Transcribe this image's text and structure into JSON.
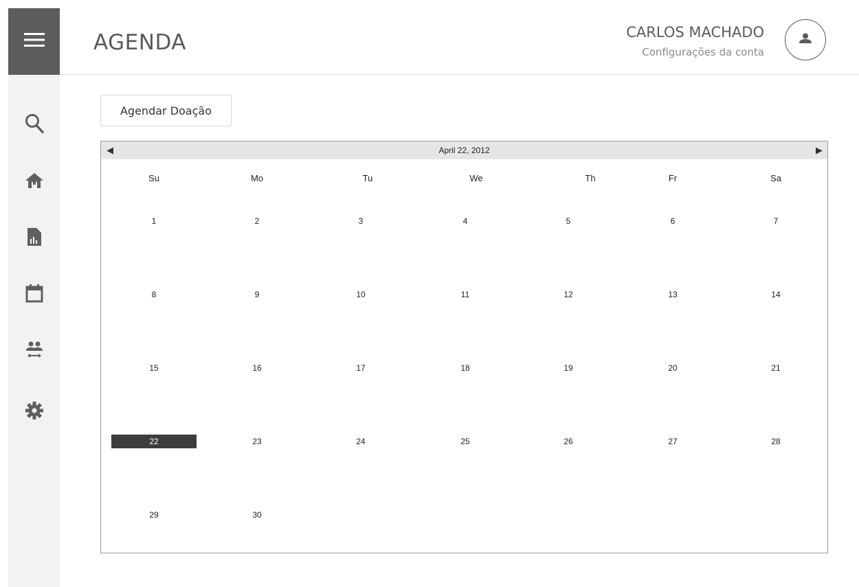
{
  "header": {
    "title": "AGENDA",
    "user_name": "CARLOS MACHADO",
    "account_settings": "Configurações da conta"
  },
  "sidebar": {
    "icons": [
      "menu-icon",
      "search-icon",
      "home-icon",
      "report-icon",
      "calendar-icon",
      "people-swap-icon",
      "gear-icon"
    ]
  },
  "actions": {
    "schedule_label": "Agendar Doação"
  },
  "calendar": {
    "title": "April 22, 2012",
    "prev": "◀",
    "next": "▶",
    "weekdays": [
      "Su",
      "Mo",
      "Tu",
      "We",
      "Th",
      "Fr",
      "Sa"
    ],
    "weeks": [
      [
        "1",
        "2",
        "3",
        "4",
        "5",
        "6",
        "7"
      ],
      [
        "8",
        "9",
        "10",
        "11",
        "12",
        "13",
        "14"
      ],
      [
        "15",
        "16",
        "17",
        "18",
        "19",
        "20",
        "21"
      ],
      [
        "22",
        "23",
        "24",
        "25",
        "26",
        "27",
        "28"
      ],
      [
        "29",
        "30",
        "",
        "",
        "",
        "",
        ""
      ]
    ],
    "selected_day": "22"
  },
  "colors": {
    "sidebar_bg": "#f2f2f2",
    "menu_bg": "#5c5c5c",
    "icon": "#5f5f5f",
    "selected_day_bg": "#3d3d3d"
  }
}
